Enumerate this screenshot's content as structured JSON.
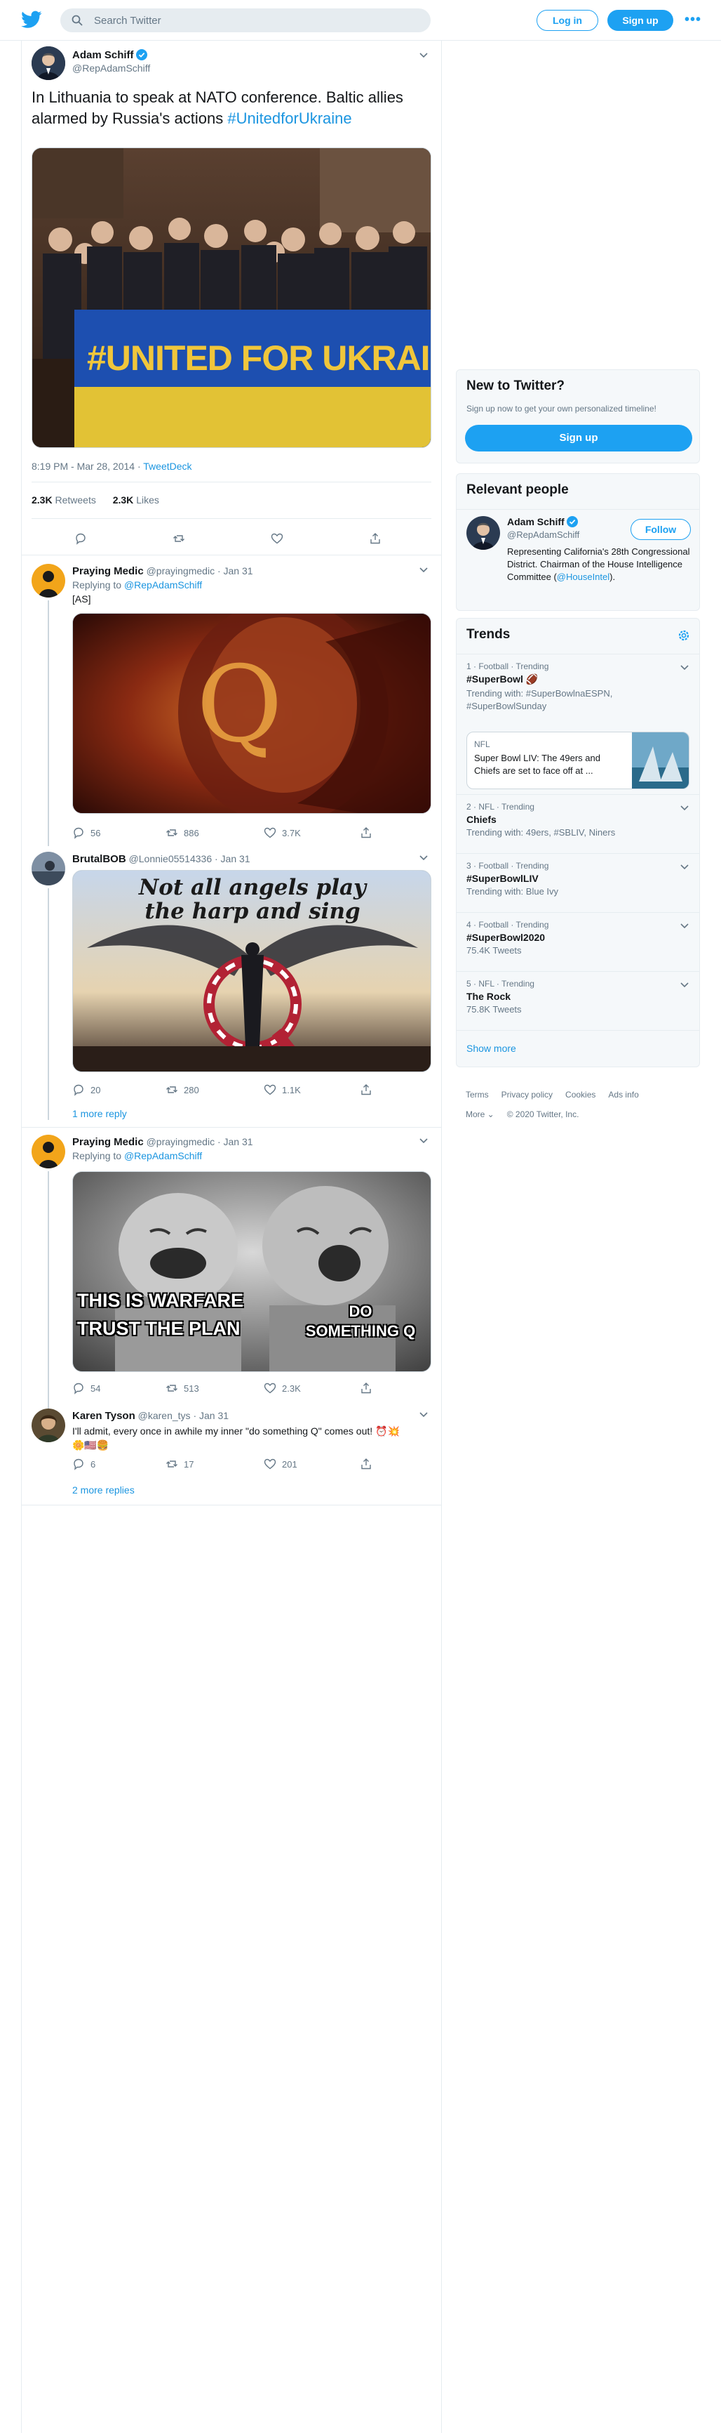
{
  "topbar": {
    "search_placeholder": "Search Twitter",
    "login_label": "Log in",
    "signup_label": "Sign up",
    "more_label": "•••"
  },
  "colors": {
    "accent": "#1da1f2",
    "link": "#1b95e0",
    "text": "#14171a",
    "muted": "#657786",
    "border": "#e6ecf0"
  },
  "main_tweet": {
    "name": "Adam Schiff",
    "handle": "@RepAdamSchiff",
    "text_plain": "In Lithuania to speak at NATO conference. Baltic allies alarmed by Russia's actions ",
    "text_hashtag": "#UnitedforUkraine",
    "banner_text": "#UNITED FOR UKRAINE",
    "timestamp": "8:19 PM - Mar 28, 2014",
    "separator": " · ",
    "client": "TweetDeck",
    "retweets_count": "2.3K",
    "retweets_label": "Retweets",
    "likes_count": "2.3K",
    "likes_label": "Likes"
  },
  "replies": [
    {
      "name": "Praying Medic",
      "handle": "@prayingmedic · Jan 31",
      "replying_prefix": "Replying to ",
      "replying_to": "@RepAdamSchiff",
      "text": "[AS]",
      "image_letter": "Q",
      "reply_count": "56",
      "retweet_count": "886",
      "like_count": "3.7K"
    },
    {
      "name": "BrutalBOB",
      "handle": "@Lonnie05514336 · Jan 31",
      "image_text_line1": "Not all angels play",
      "image_text_line2": "the harp and sing",
      "reply_count": "20",
      "retweet_count": "280",
      "like_count": "1.1K",
      "more_replies": "1 more reply"
    },
    {
      "name": "Praying Medic",
      "handle": "@prayingmedic · Jan 31",
      "replying_prefix": "Replying to ",
      "replying_to": "@RepAdamSchiff",
      "image_text_left_1": "THIS IS WARFARE",
      "image_text_left_2": "TRUST THE PLAN",
      "image_text_right_1": "DO",
      "image_text_right_2": "SOMETHING Q",
      "reply_count": "54",
      "retweet_count": "513",
      "like_count": "2.3K"
    },
    {
      "name": "Karen Tyson",
      "handle": "@karen_tys · Jan 31",
      "text_line1": "I'll admit, every once in awhile my inner \"do something Q\" comes out! ⏰💥",
      "text_line2": "🌼🇺🇸🍔",
      "reply_count": "6",
      "retweet_count": "17",
      "like_count": "201",
      "more_replies": "2 more replies"
    }
  ],
  "sidebar": {
    "new_title": "New to Twitter?",
    "new_sub": "Sign up now to get your own personalized timeline!",
    "new_button": "Sign up",
    "relevant_title": "Relevant people",
    "person_name": "Adam Schiff",
    "person_handle": "@RepAdamSchiff",
    "person_bio": "Representing California's 28th Congressional District. Chairman of the House Intelligence Committee (",
    "person_bio_link": "@HouseIntel",
    "person_bio_end": ").",
    "follow_label": "Follow",
    "trends_title": "Trends",
    "trends": [
      {
        "meta": "1 · Football · Trending",
        "name": "#SuperBowl 🏈",
        "sub": "Trending with: #SuperBowlnaESPN, #SuperBowlSunday"
      },
      {
        "meta": "2 · NFL · Trending",
        "name": "Chiefs",
        "sub": "Trending with: 49ers, #SBLIV, Niners"
      },
      {
        "meta": "3 · Football · Trending",
        "name": "#SuperBowlLIV",
        "sub": "Trending with: Blue Ivy"
      },
      {
        "meta": "4 · Football · Trending",
        "name": "#SuperBowl2020",
        "sub": "75.4K Tweets"
      },
      {
        "meta": "5 · NFL · Trending",
        "name": "The Rock",
        "sub": "75.8K Tweets"
      }
    ],
    "news_meta": "NFL",
    "news_text": "Super Bowl LIV: The 49ers and Chiefs are set to face off at ...",
    "show_more": "Show more",
    "footer": [
      "Terms",
      "Privacy policy",
      "Cookies",
      "Ads info"
    ],
    "footer_more": "More ⌄",
    "copyright": "© 2020 Twitter, Inc."
  }
}
